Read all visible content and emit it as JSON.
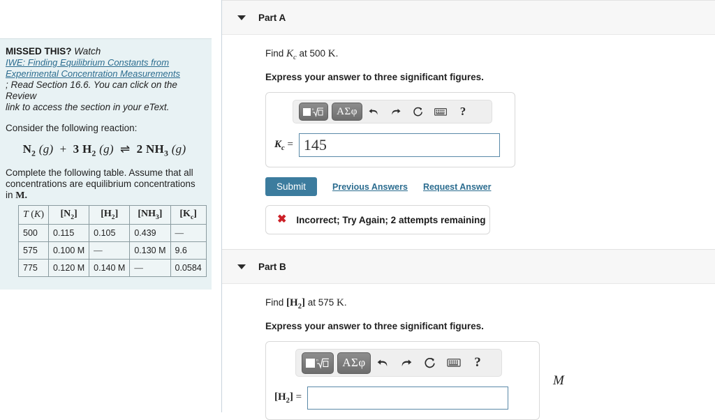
{
  "hint": {
    "label": "MISSED THIS?",
    "watch": "Watch",
    "link_line1": "IWE: Finding Equilibrium Constants from",
    "link_line2": "Experimental Concentration Measurements",
    "tail_line1": "; Read Section 16.6. You can click on the Review",
    "tail_line2": "link to access the section in your eText.",
    "consider": "Consider the following reaction:",
    "reaction": "N2 (g) + 3 H2 (g) ⇌ 2 NH3 (g)",
    "complete_line1": "Complete the following table. Assume that all",
    "complete_line2": "concentrations are equilibrium concentrations in",
    "complete_unit": "M."
  },
  "table": {
    "headers": [
      "T (K)",
      "[N2]",
      "[H2]",
      "[NH3]",
      "[Kc]"
    ],
    "rows": [
      {
        "T": "500",
        "N2": "0.115",
        "H2": "0.105",
        "NH3": "0.439",
        "Kc": "—"
      },
      {
        "T": "575",
        "N2": "0.100 M",
        "H2": "—",
        "NH3": "0.130 M",
        "Kc": "9.6"
      },
      {
        "T": "775",
        "N2": "0.120 M",
        "H2": "0.140 M",
        "NH3": "—",
        "Kc": "0.0584"
      }
    ]
  },
  "toolbar": {
    "greek_label": "ΑΣφ",
    "help_label": "?"
  },
  "part_a": {
    "title": "Part A",
    "question_prefix": "Find",
    "question_symbol": "Kc",
    "question_suffix": "at 500 K.",
    "instruction": "Express your answer to three significant figures.",
    "field_label": "Kc =",
    "answer_value": "145",
    "submit_label": "Submit",
    "previous_answers_label": "Previous Answers",
    "request_answer_label": "Request Answer",
    "feedback_text": "Incorrect; Try Again; 2 attempts remaining",
    "feedback_icon": "✖"
  },
  "part_b": {
    "title": "Part B",
    "question_prefix": "Find",
    "question_symbol": "[H2]",
    "question_suffix": "at 575 K.",
    "instruction": "Express your answer to three significant figures.",
    "field_label": "[H2] =",
    "answer_value": "",
    "unit": "M"
  },
  "colors": {
    "accent": "#3c7ca0",
    "link": "#2b6c8f",
    "error": "#cc2027",
    "panel_bg": "#e8f2f4",
    "header_bg": "#f7f7f7"
  }
}
